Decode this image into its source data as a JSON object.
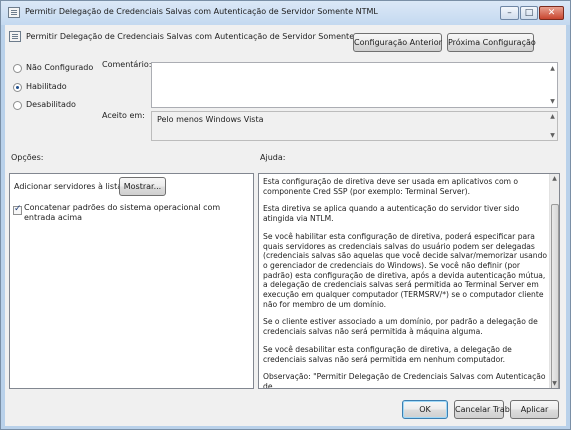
{
  "window": {
    "title": "Permitir Delegação de Credenciais Salvas com Autenticação de Servidor Somente NTML"
  },
  "header": {
    "policy_title": "Permitir Delegação de Credenciais Salvas com Autenticação de Servidor Somente NTML",
    "prev_button": "Configuração Anterior",
    "next_button": "Próxima Configuração"
  },
  "state": {
    "options": [
      {
        "label": "Não Configurado",
        "selected": false
      },
      {
        "label": "Habilitado",
        "selected": true
      },
      {
        "label": "Desabilitado",
        "selected": false
      }
    ]
  },
  "comment": {
    "label": "Comentário:",
    "value": ""
  },
  "supported": {
    "label": "Aceito em:",
    "value": "Pelo menos Windows Vista"
  },
  "options_section": {
    "label": "Opções:",
    "add_servers_label": "Adicionar servidores à lista:",
    "show_button": "Mostrar...",
    "concat_checkbox_label": "Concatenar padrões do sistema operacional com entrada acima",
    "concat_checked": true
  },
  "help_section": {
    "label": "Ajuda:",
    "paragraphs": [
      "Esta configuração de diretiva deve ser usada em aplicativos com o componente Cred SSP (por exemplo: Terminal Server).",
      "Esta diretiva se aplica quando a autenticação do servidor tiver sido atingida via NTLM.",
      "Se você habilitar esta configuração de diretiva, poderá especificar para quais servidores as credenciais salvas do usuário podem ser delegadas (credenciais salvas são aquelas que você decide salvar/memorizar usando o gerenciador de credenciais do Windows). Se você não definir (por padrão) esta configuração de diretiva, após a devida autenticação mútua, a delegação de credenciais salvas será permitida ao Terminal Server em execução em qualquer computador (TERMSRV/*) se o computador cliente não for membro de um domínio.",
      "Se o cliente estiver associado a um domínio, por padrão a delegação de credenciais salvas não será permitida à máquina alguma.",
      "Se você desabilitar esta configuração de diretiva, a delegação de credenciais salvas não será permitida em nenhum computador.",
      "Observação: \"Permitir Delegação de Credenciais Salvas com Autenticação de"
    ]
  },
  "footer": {
    "ok_button": "OK",
    "cancel_button": "Cancelar Trabalho",
    "apply_button": "Aplicar"
  },
  "colors": {
    "window_border": "#b9d1ea",
    "client_bg": "#f0f0f0",
    "close_button": "#c8452f"
  }
}
